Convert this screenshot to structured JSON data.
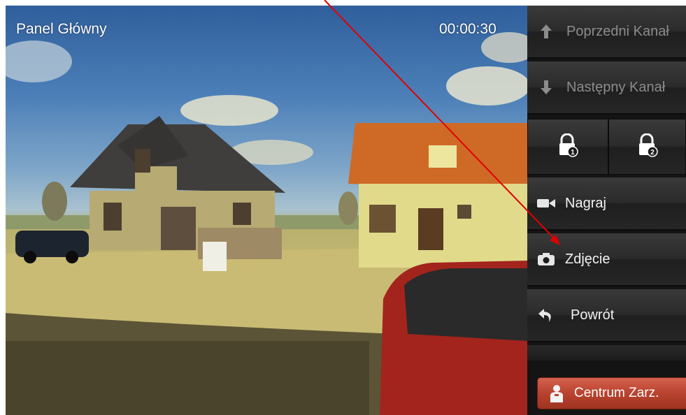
{
  "video": {
    "title": "Panel Główny",
    "timer": "00:00:30"
  },
  "panel": {
    "prev_channel": "Poprzedni Kanał",
    "next_channel": "Następny Kanał",
    "lock1_icon": "lock-1-icon",
    "lock2_icon": "lock-2-icon",
    "record": "Nagraj",
    "snapshot": "Zdjęcie",
    "back": "Powrót",
    "centrum": "Centrum Zarz."
  },
  "colors": {
    "panel_bg": "#141414",
    "centrum_red": "#b8432f",
    "annotation_arrow": "#e00000"
  }
}
